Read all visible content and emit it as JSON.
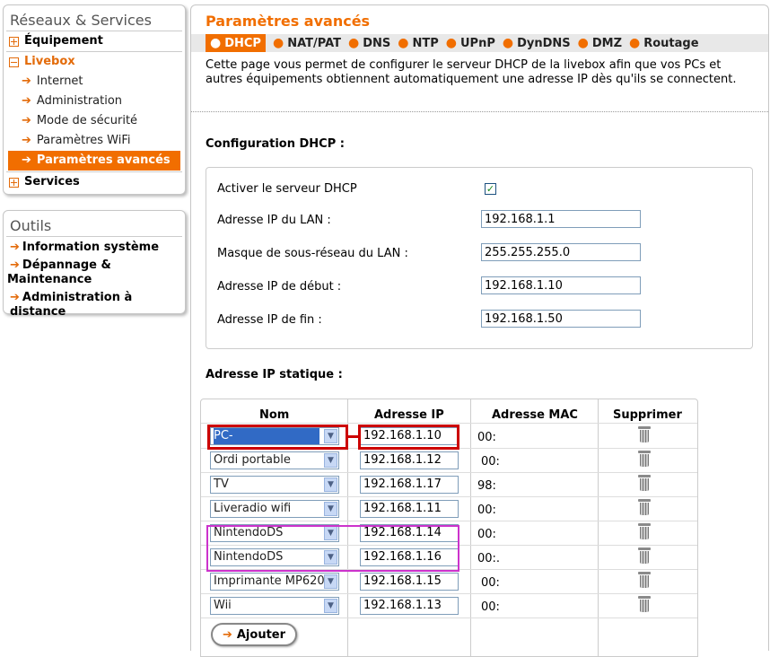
{
  "sidebar": {
    "title": "Réseaux & Services",
    "groups": {
      "equipment": "Équipement",
      "livebox": "Livebox",
      "services": "Services"
    },
    "livebox_items": [
      "Internet",
      "Administration",
      "Mode de sécurité",
      "Paramètres WiFi",
      "Paramètres avancés"
    ]
  },
  "tools": {
    "title": "Outils",
    "items": [
      "Information système",
      "Dépannage &",
      "Maintenance",
      "Administration à distance"
    ]
  },
  "main": {
    "title": "Paramètres avancés",
    "tabs": [
      "DHCP",
      "NAT/PAT",
      "DNS",
      "NTP",
      "UPnP",
      "DynDNS",
      "DMZ",
      "Routage"
    ],
    "description_line1": "Cette page vous permet de configurer le serveur DHCP de la livebox afin que vos PCs et",
    "description_line2": "autres équipements obtiennent automatiquement une adresse IP dès qu'ils se connectent."
  },
  "dhcp": {
    "heading": "Configuration DHCP :",
    "enable_label": "Activer le serveur DHCP",
    "lan_ip_label": "Adresse IP du LAN :",
    "lan_ip": "192.168.1.1",
    "mask_label": "Masque de sous-réseau du LAN :",
    "mask": "255.255.255.0",
    "start_label": "Adresse IP de début :",
    "start": "192.168.1.10",
    "end_label": "Adresse IP de fin :",
    "end": "192.168.1.50"
  },
  "static": {
    "heading": "Adresse IP statique :",
    "columns": [
      "Nom",
      "Adresse IP",
      "Adresse MAC",
      "Supprimer"
    ],
    "rows": [
      {
        "name": "PC-",
        "ip": "192.168.1.10",
        "mac": "00:"
      },
      {
        "name": "Ordi portable",
        "ip": "192.168.1.12",
        "mac": "00:"
      },
      {
        "name": "TV",
        "ip": "192.168.1.17",
        "mac": "98:"
      },
      {
        "name": "Liveradio wifi",
        "ip": "192.168.1.11",
        "mac": "00:"
      },
      {
        "name": "NintendoDS",
        "ip": "192.168.1.14",
        "mac": "00:"
      },
      {
        "name": "NintendoDS",
        "ip": "192.168.1.16",
        "mac": "00:."
      },
      {
        "name": "Imprimante MP620",
        "ip": "192.168.1.15",
        "mac": "00:"
      },
      {
        "name": "Wii",
        "ip": "192.168.1.13",
        "mac": "00:"
      }
    ],
    "add_label": "Ajouter"
  },
  "icons": {
    "arrow": "arrow-right-icon",
    "trash": "trash-icon",
    "expand": "plus-box-icon",
    "collapse": "minus-box-icon",
    "check": "checkmark-icon",
    "dropdown": "chevron-down-icon"
  }
}
